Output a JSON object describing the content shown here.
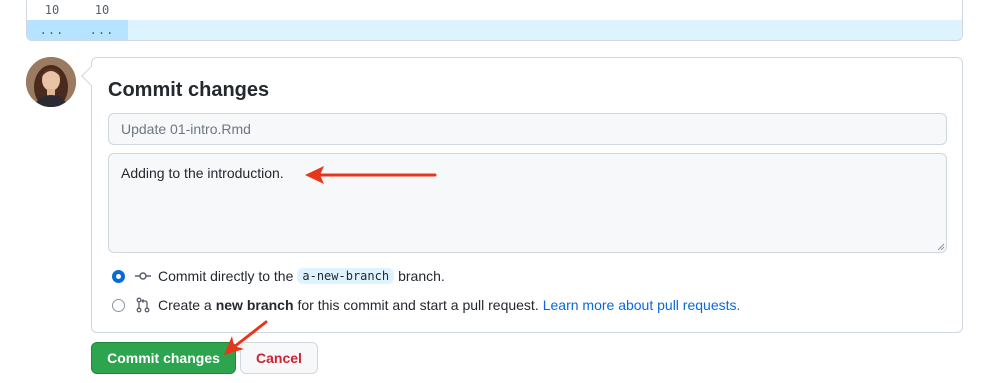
{
  "diff": {
    "row1": {
      "old_line": "10",
      "new_line": "10"
    },
    "row2": {
      "old_line": "...",
      "new_line": "..."
    }
  },
  "commit": {
    "title": "Commit changes",
    "summary_placeholder": "Update 01-intro.Rmd",
    "description_value": "Adding to the introduction.",
    "options": {
      "direct": {
        "selected": true,
        "text_before": "Commit directly to the",
        "branch_name": "a-new-branch",
        "text_after": "branch."
      },
      "new_branch": {
        "selected": false,
        "text_before": "Create a",
        "bold_text": "new branch",
        "text_after": "for this commit and start a pull request.",
        "link_text": "Learn more about pull requests."
      }
    }
  },
  "buttons": {
    "commit_label": "Commit changes",
    "cancel_label": "Cancel"
  },
  "icons": {
    "avatar": "user-avatar",
    "commit": "git-commit-icon",
    "pull_request": "git-pull-request-icon",
    "annotation": "red-arrow-icon"
  },
  "colors": {
    "primary_green": "#2da44e",
    "link_blue": "#0969da",
    "cancel_red": "#cf222e",
    "annotation_red": "#e8361c",
    "diff_highlight": "#ddf4ff"
  }
}
